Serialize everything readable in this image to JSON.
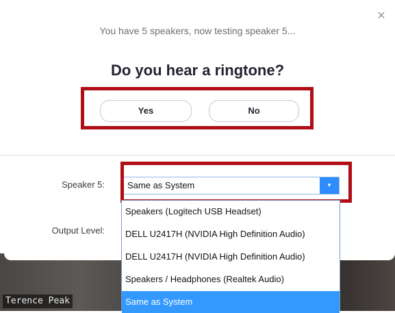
{
  "dialog": {
    "close_icon": "close-icon",
    "subtitle": "You have 5 speakers, now testing speaker 5...",
    "question": "Do you hear a ringtone?",
    "yes_label": "Yes",
    "no_label": "No"
  },
  "settings": {
    "speaker_label": "Speaker 5:",
    "output_level_label": "Output Level:",
    "selected_speaker": "Same as System",
    "options": [
      "Speakers (Logitech USB Headset)",
      "DELL U2417H (NVIDIA High Definition Audio)",
      "DELL U2417H (NVIDIA High Definition Audio)",
      "Speakers / Headphones (Realtek Audio)",
      "Same as System"
    ],
    "selected_index": 4
  },
  "video": {
    "participant_name": "Terence Peak"
  },
  "colors": {
    "highlight_box": "#b00d17",
    "accent": "#2d8cff",
    "selected_option": "#3399ff"
  }
}
